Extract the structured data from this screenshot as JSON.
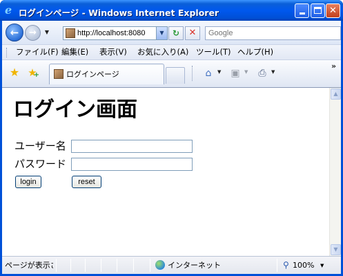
{
  "window": {
    "title": "ログインページ - Windows Internet Explorer",
    "ie_icon": "e"
  },
  "navigation": {
    "address": "http://localhost:8080",
    "search_placeholder": "Google"
  },
  "menu": {
    "items": [
      "ファイル(F)",
      "編集(E)",
      "表示(V)",
      "お気に入り(A)",
      "ツール(T)",
      "ヘルプ(H)"
    ]
  },
  "tabs": {
    "active_label": "ログインページ"
  },
  "page": {
    "heading": "ログイン画面",
    "username_label": "ユーザー名",
    "password_label": "パスワード",
    "username_value": "",
    "password_value": "",
    "login_button": "login",
    "reset_button": "reset"
  },
  "status": {
    "text": "ページが表示されました",
    "zone": "インターネット",
    "zoom": "100%"
  },
  "icons": [
    "ie-logo-icon",
    "back-arrow-icon",
    "forward-arrow-icon",
    "page-favicon-icon",
    "refresh-icon",
    "stop-icon",
    "favorites-star-icon",
    "add-favorites-icon",
    "home-icon",
    "feeds-icon",
    "print-icon",
    "globe-icon",
    "zoom-magnifier-icon"
  ]
}
